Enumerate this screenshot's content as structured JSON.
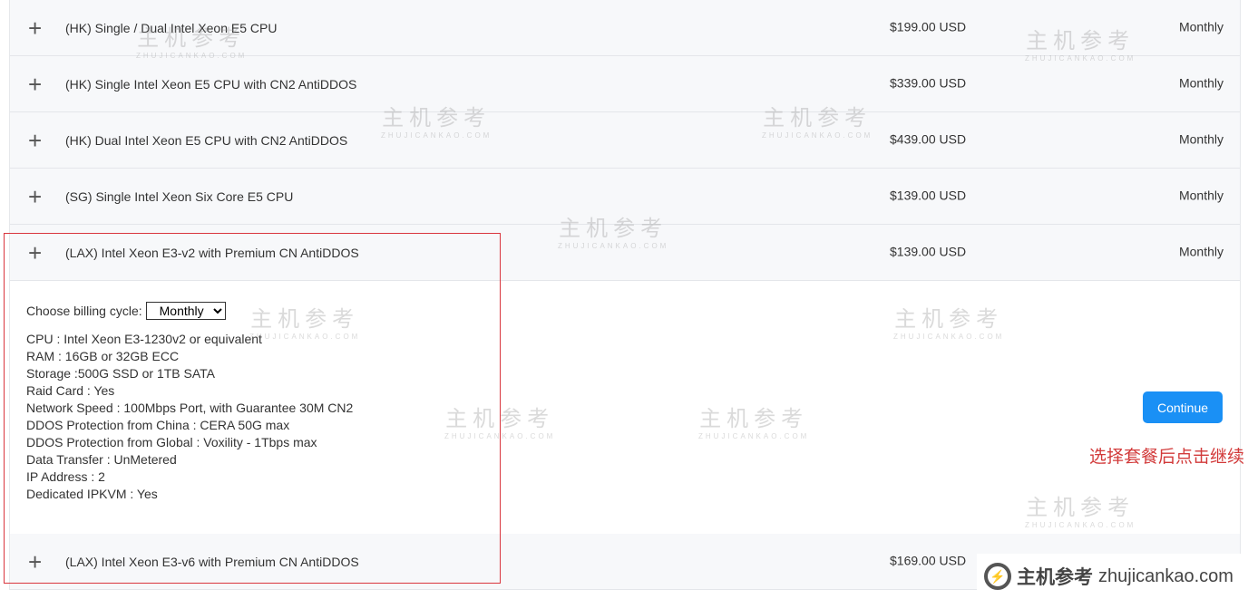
{
  "products": [
    {
      "name": "(HK) Single / Dual Intel Xeon E5 CPU",
      "price": "$199.00 USD",
      "cycle": "Monthly"
    },
    {
      "name": "(HK) Single Intel Xeon E5 CPU with CN2 AntiDDOS",
      "price": "$339.00 USD",
      "cycle": "Monthly"
    },
    {
      "name": "(HK) Dual Intel Xeon E5 CPU with CN2 AntiDDOS",
      "price": "$439.00 USD",
      "cycle": "Monthly"
    },
    {
      "name": "(SG) Single Intel Xeon Six Core E5 CPU",
      "price": "$139.00 USD",
      "cycle": "Monthly"
    },
    {
      "name": "(LAX) Intel Xeon E3-v2 with Premium CN AntiDDOS",
      "price": "$139.00 USD",
      "cycle": "Monthly"
    },
    {
      "name": "(LAX) Intel Xeon E3-v6 with Premium CN AntiDDOS",
      "price": "$169.00 USD",
      "cycle": ""
    }
  ],
  "detail": {
    "billing_label": "Choose billing cycle:",
    "billing_value": "Monthly",
    "specs": [
      "CPU  : Intel Xeon E3-1230v2 or equivalent",
      "RAM : 16GB or 32GB ECC",
      "Storage :500G SSD or 1TB SATA",
      "Raid Card : Yes",
      "Network Speed : 100Mbps Port, with Guarantee 30M CN2",
      "DDOS Protection from China : CERA 50G max",
      "DDOS Protection from Global : Voxility - 1Tbps max",
      "Data Transfer : UnMetered",
      "IP Address : 2",
      "Dedicated IPKVM : Yes"
    ],
    "continue_label": "Continue"
  },
  "annotation": "选择套餐后点击继续",
  "watermark": {
    "cn": "主机参考",
    "en": "ZHUJICANKAO.COM",
    "domain": "zhujicankao.com"
  },
  "colors": {
    "accent": "#1a90f5",
    "annotation": "#d23a3a"
  }
}
